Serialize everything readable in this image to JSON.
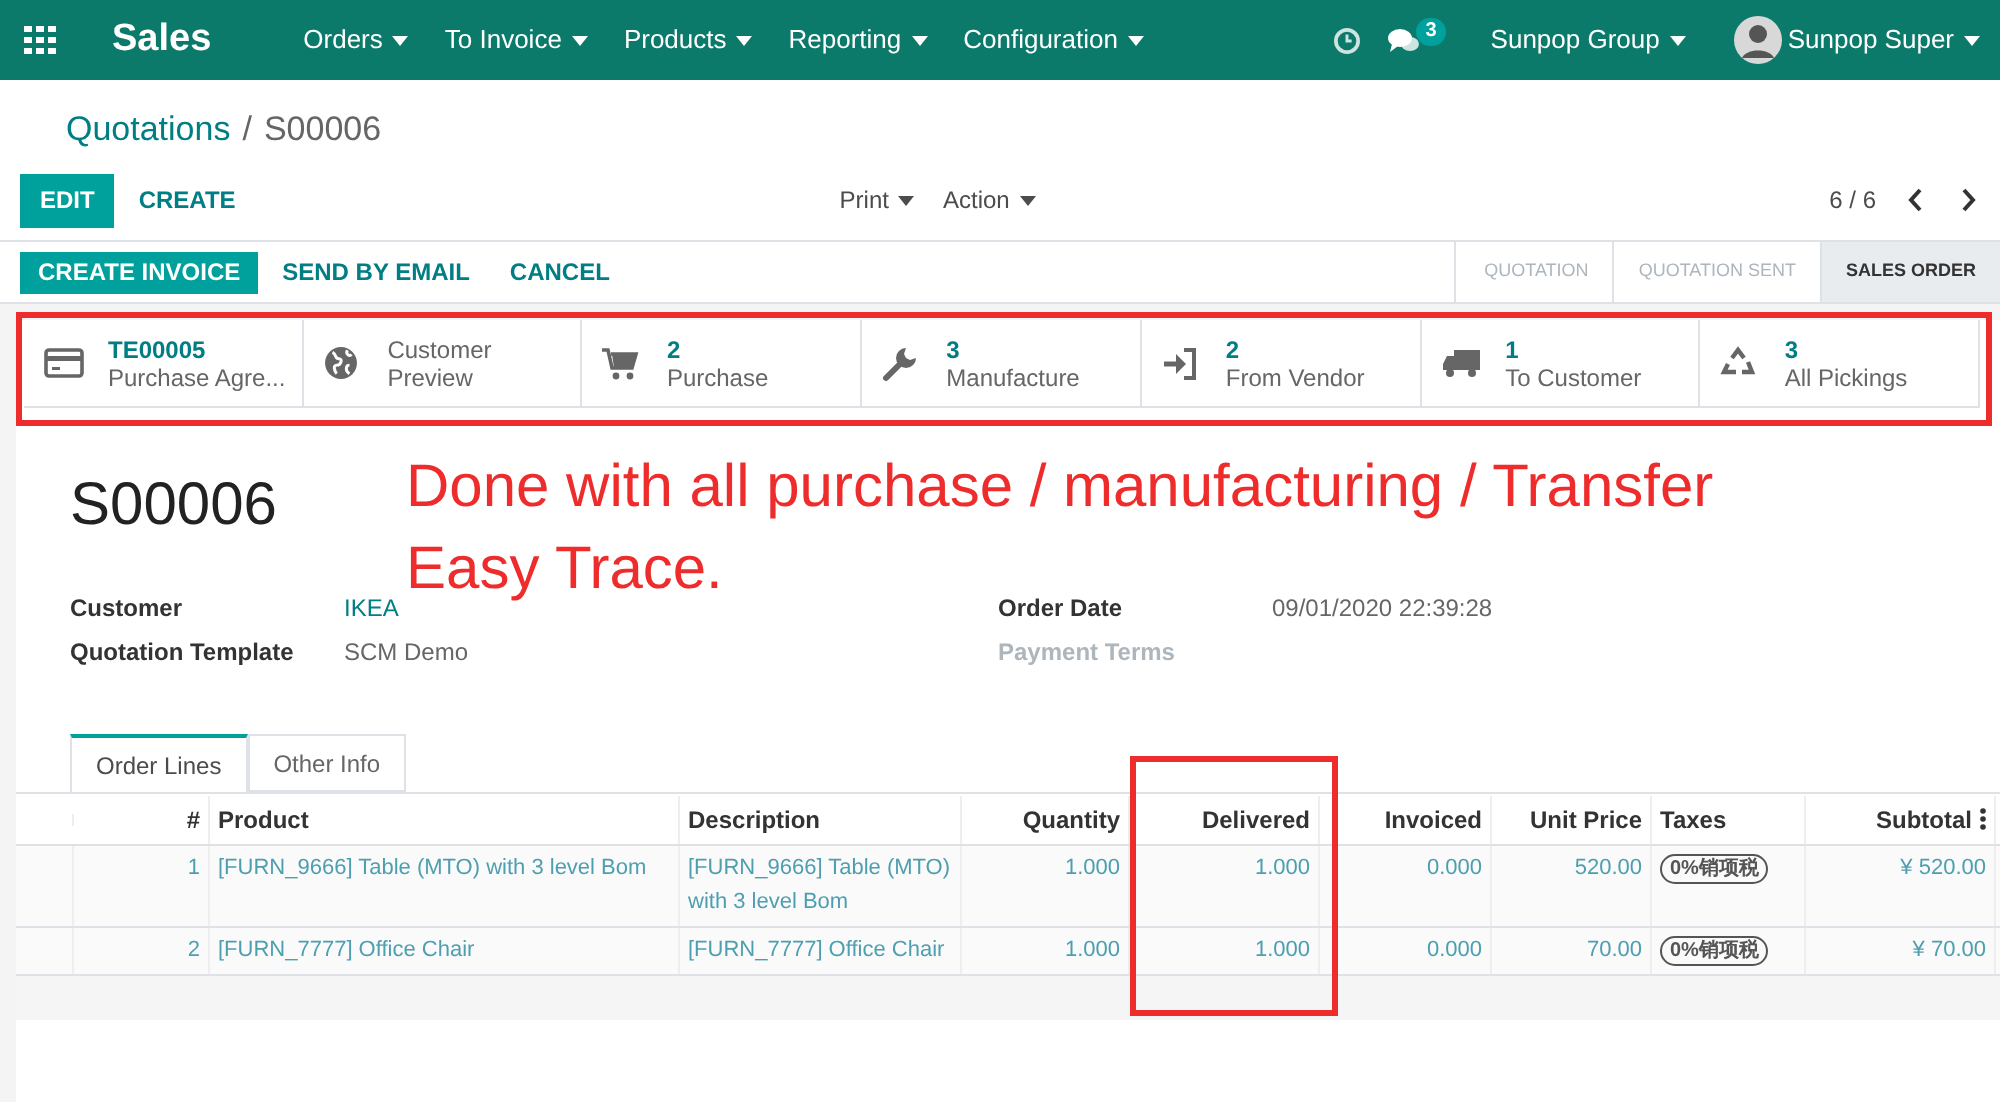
{
  "app": {
    "title": "Sales"
  },
  "menu": [
    {
      "label": "Orders"
    },
    {
      "label": "To Invoice"
    },
    {
      "label": "Products"
    },
    {
      "label": "Reporting"
    },
    {
      "label": "Configuration"
    }
  ],
  "systray": {
    "message_count": "3",
    "company": "Sunpop Group",
    "user": "Sunpop Super"
  },
  "breadcrumb": {
    "parent": "Quotations",
    "separator": "/",
    "current": "S00006"
  },
  "toolbar": {
    "primary": "EDIT",
    "secondary": "CREATE",
    "menus": [
      "Print",
      "Action"
    ],
    "pager": "6 / 6"
  },
  "header_buttons": [
    {
      "label": "CREATE INVOICE",
      "primary": true
    },
    {
      "label": "SEND BY EMAIL",
      "primary": false
    },
    {
      "label": "CANCEL",
      "primary": false
    }
  ],
  "stages": [
    {
      "label": "QUOTATION",
      "selected": false
    },
    {
      "label": "QUOTATION SENT",
      "selected": false
    },
    {
      "label": "SALES ORDER",
      "selected": true
    }
  ],
  "smart_buttons": [
    {
      "value": "TE00005",
      "label": "Purchase Agre..."
    },
    {
      "label": "Customer Preview"
    },
    {
      "value": "2",
      "label": "Purchase"
    },
    {
      "value": "3",
      "label": "Manufacture"
    },
    {
      "value": "2",
      "label": "From Vendor"
    },
    {
      "value": "1",
      "label": "To Customer"
    },
    {
      "value": "3",
      "label": "All Pickings"
    }
  ],
  "annotation": {
    "lines": [
      "Done with all purchase / manufacturing / Transfer",
      "Easy Trace."
    ]
  },
  "record": {
    "name": "S00006"
  },
  "fields_left": [
    {
      "label": "Customer",
      "value": "IKEA",
      "link": true
    },
    {
      "label": "Quotation Template",
      "value": "SCM Demo",
      "link": false
    }
  ],
  "fields_right": [
    {
      "label": "Order Date",
      "value": "09/01/2020 22:39:28",
      "muted": false
    },
    {
      "label": "Payment Terms",
      "muted": true
    }
  ],
  "tabs": [
    {
      "label": "Order Lines",
      "selected": true
    },
    {
      "label": "Other Info",
      "selected": false
    }
  ],
  "table": {
    "columns": [
      "#",
      "Product",
      "Description",
      "Quantity",
      "Delivered",
      "Invoiced",
      "Unit Price",
      "Taxes",
      "Subtotal"
    ],
    "rows": [
      {
        "number": "1",
        "product": "[FURN_9666] Table (MTO) with 3 level Bom",
        "description": "[FURN_9666] Table (MTO) with 3 level Bom",
        "quantity": "1.000",
        "delivered": "1.000",
        "invoiced": "0.000",
        "unit_price": "520.00",
        "taxes": "0%销项税",
        "subtotal": "¥ 520.00"
      },
      {
        "number": "2",
        "product": "[FURN_7777] Office Chair",
        "description": "[FURN_7777] Office Chair",
        "quantity": "1.000",
        "delivered": "1.000",
        "invoiced": "0.000",
        "unit_price": "70.00",
        "taxes": "0%销项税",
        "subtotal": "¥ 70.00"
      }
    ]
  }
}
